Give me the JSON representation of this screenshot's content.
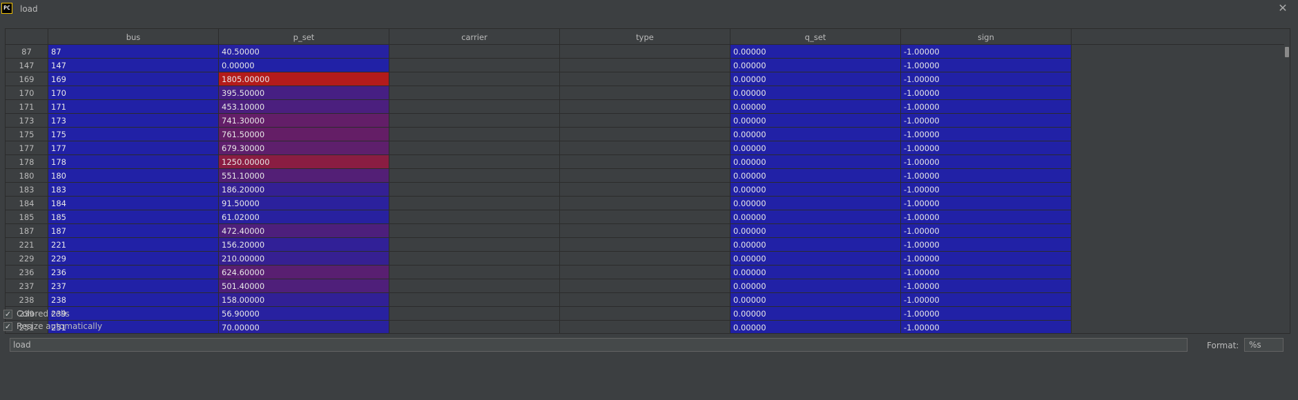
{
  "window": {
    "title": "load",
    "app_icon": "pycharm-icon",
    "close_icon": "close-icon"
  },
  "table": {
    "columns": [
      "bus",
      "p_set",
      "carrier",
      "type",
      "q_set",
      "sign"
    ],
    "rows": [
      {
        "index": "87",
        "bus": "87",
        "p_set": "40.50000",
        "carrier": "",
        "type": "",
        "q_set": "0.00000",
        "sign": "-1.00000"
      },
      {
        "index": "147",
        "bus": "147",
        "p_set": "0.00000",
        "carrier": "",
        "type": "",
        "q_set": "0.00000",
        "sign": "-1.00000"
      },
      {
        "index": "169",
        "bus": "169",
        "p_set": "1805.00000",
        "carrier": "",
        "type": "",
        "q_set": "0.00000",
        "sign": "-1.00000"
      },
      {
        "index": "170",
        "bus": "170",
        "p_set": "395.50000",
        "carrier": "",
        "type": "",
        "q_set": "0.00000",
        "sign": "-1.00000"
      },
      {
        "index": "171",
        "bus": "171",
        "p_set": "453.10000",
        "carrier": "",
        "type": "",
        "q_set": "0.00000",
        "sign": "-1.00000"
      },
      {
        "index": "173",
        "bus": "173",
        "p_set": "741.30000",
        "carrier": "",
        "type": "",
        "q_set": "0.00000",
        "sign": "-1.00000"
      },
      {
        "index": "175",
        "bus": "175",
        "p_set": "761.50000",
        "carrier": "",
        "type": "",
        "q_set": "0.00000",
        "sign": "-1.00000"
      },
      {
        "index": "177",
        "bus": "177",
        "p_set": "679.30000",
        "carrier": "",
        "type": "",
        "q_set": "0.00000",
        "sign": "-1.00000"
      },
      {
        "index": "178",
        "bus": "178",
        "p_set": "1250.00000",
        "carrier": "",
        "type": "",
        "q_set": "0.00000",
        "sign": "-1.00000"
      },
      {
        "index": "180",
        "bus": "180",
        "p_set": "551.10000",
        "carrier": "",
        "type": "",
        "q_set": "0.00000",
        "sign": "-1.00000"
      },
      {
        "index": "183",
        "bus": "183",
        "p_set": "186.20000",
        "carrier": "",
        "type": "",
        "q_set": "0.00000",
        "sign": "-1.00000"
      },
      {
        "index": "184",
        "bus": "184",
        "p_set": "91.50000",
        "carrier": "",
        "type": "",
        "q_set": "0.00000",
        "sign": "-1.00000"
      },
      {
        "index": "185",
        "bus": "185",
        "p_set": "61.02000",
        "carrier": "",
        "type": "",
        "q_set": "0.00000",
        "sign": "-1.00000"
      },
      {
        "index": "187",
        "bus": "187",
        "p_set": "472.40000",
        "carrier": "",
        "type": "",
        "q_set": "0.00000",
        "sign": "-1.00000"
      },
      {
        "index": "221",
        "bus": "221",
        "p_set": "156.20000",
        "carrier": "",
        "type": "",
        "q_set": "0.00000",
        "sign": "-1.00000"
      },
      {
        "index": "229",
        "bus": "229",
        "p_set": "210.00000",
        "carrier": "",
        "type": "",
        "q_set": "0.00000",
        "sign": "-1.00000"
      },
      {
        "index": "236",
        "bus": "236",
        "p_set": "624.60000",
        "carrier": "",
        "type": "",
        "q_set": "0.00000",
        "sign": "-1.00000"
      },
      {
        "index": "237",
        "bus": "237",
        "p_set": "501.40000",
        "carrier": "",
        "type": "",
        "q_set": "0.00000",
        "sign": "-1.00000"
      },
      {
        "index": "238",
        "bus": "238",
        "p_set": "158.00000",
        "carrier": "",
        "type": "",
        "q_set": "0.00000",
        "sign": "-1.00000"
      },
      {
        "index": "239",
        "bus": "239",
        "p_set": "56.90000",
        "carrier": "",
        "type": "",
        "q_set": "0.00000",
        "sign": "-1.00000"
      },
      {
        "index": "251",
        "bus": "251",
        "p_set": "70.00000",
        "carrier": "",
        "type": "",
        "q_set": "0.00000",
        "sign": "-1.00000"
      }
    ],
    "colors": {
      "low": "#2121a6",
      "high": "#b31b1b"
    }
  },
  "bottom": {
    "name_value": "load",
    "format_label": "Format:",
    "format_value": "%s"
  },
  "options": {
    "colored_cells_label": "Colored cells",
    "colored_cells_checked": true,
    "resize_label": "Resize automatically",
    "resize_checked": true
  }
}
